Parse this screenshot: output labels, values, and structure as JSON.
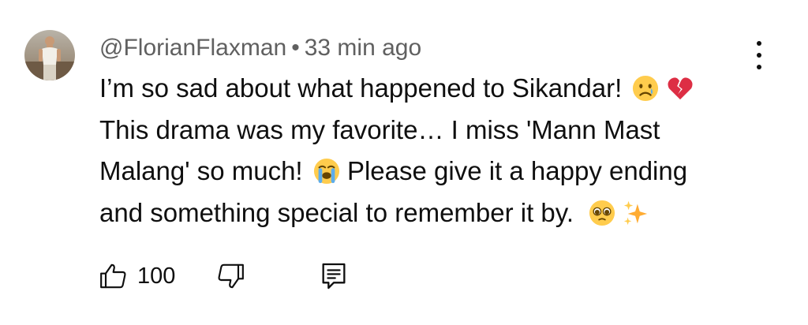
{
  "comment": {
    "author": "@FlorianFlaxman",
    "separator": "•",
    "timestamp": "33 min ago",
    "lines": [
      "I’m so sad about what happened to Sikandar!",
      "This drama was my favorite… I miss 'Mann Mast",
      "Malang' so much!",
      "Please give it a happy ending",
      "and something special to remember it by."
    ],
    "emojis": [
      "crying-face-emoji",
      "broken-heart-emoji",
      "loudly-crying-face-emoji",
      "pleading-face-emoji",
      "sparkles-emoji"
    ],
    "like_count": "100"
  },
  "icons": {
    "more": "vertical-dots-icon",
    "like": "thumb-up-icon",
    "dislike": "thumb-down-icon",
    "reply": "reply-comment-icon"
  }
}
